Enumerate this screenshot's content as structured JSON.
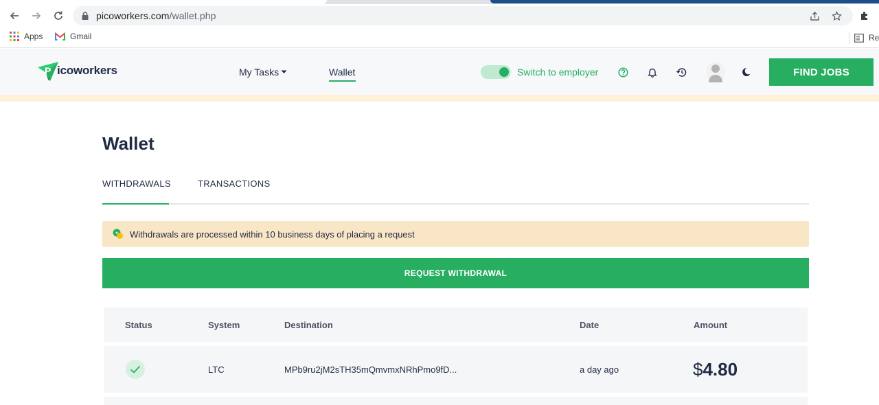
{
  "browser": {
    "url_host": "picoworkers.com",
    "url_path": "/wallet.php",
    "bookmarks": [
      {
        "label": "Apps",
        "icon": "apps-grid-icon"
      },
      {
        "label": "Gmail",
        "icon": "gmail-icon"
      }
    ],
    "reading_list_label": "Re"
  },
  "header": {
    "logo_text": "icoworkers",
    "logo_letter": "P",
    "nav": {
      "my_tasks": "My Tasks",
      "wallet": "Wallet"
    },
    "switch_label": "Switch to employer",
    "find_jobs": "FIND JOBS"
  },
  "main": {
    "title": "Wallet",
    "tabs": [
      {
        "label": "WITHDRAWALS",
        "active": true
      },
      {
        "label": "TRANSACTIONS",
        "active": false
      }
    ],
    "notice": "Withdrawals are processed within 10 business days of placing a request",
    "request_button": "REQUEST WITHDRAWAL",
    "table": {
      "columns": [
        "Status",
        "System",
        "Destination",
        "Date",
        "Amount"
      ],
      "rows": [
        {
          "status": "completed",
          "system": "LTC",
          "destination": "MPb9ru2jM2sTH35mQmvmxNRhPmo9fD...",
          "date": "a day ago",
          "amount_currency": "$",
          "amount_value": "4.80"
        }
      ]
    }
  },
  "colors": {
    "accent_green": "#27ae60",
    "navy_text": "#1f2a44",
    "notice_bg": "#f9e6c6"
  }
}
